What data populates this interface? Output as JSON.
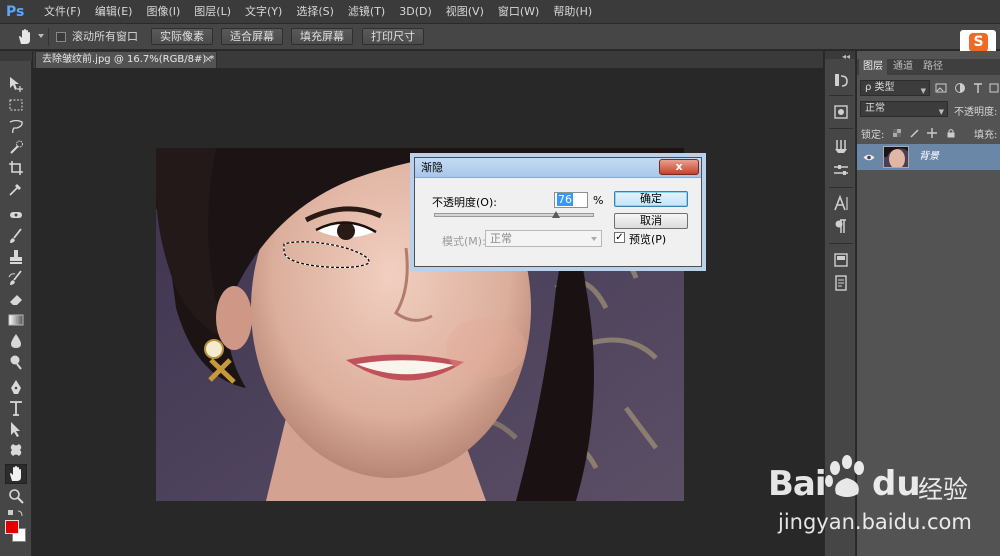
{
  "app": {
    "logo": "Ps",
    "menu": [
      "文件(F)",
      "编辑(E)",
      "图像(I)",
      "图层(L)",
      "文字(Y)",
      "选择(S)",
      "滤镜(T)",
      "3D(D)",
      "视图(V)",
      "窗口(W)",
      "帮助(H)"
    ]
  },
  "options_bar": {
    "tool_icon": "hand-icon",
    "scroll_all_windows_label": "滚动所有窗口",
    "scroll_all_windows_checked": false,
    "buttons": [
      "实际像素",
      "适合屏幕",
      "填充屏幕",
      "打印尺寸"
    ]
  },
  "document": {
    "tab_title": "去除皱纹前.jpg @ 16.7%(RGB/8#) *",
    "close_glyph": "×"
  },
  "fade_dialog": {
    "title": "渐隐",
    "close_glyph": "x",
    "opacity_label": "不透明度(O):",
    "opacity_value": "76",
    "opacity_unit": "%",
    "opacity_slider_level": 0.76,
    "mode_label": "模式(M):",
    "mode_value": "正常",
    "ok_label": "确定",
    "cancel_label": "取消",
    "preview_label": "预览(P)",
    "preview_checked": true,
    "preview_check_glyph": "✓"
  },
  "layers_panel": {
    "tabs": [
      "图层",
      "通道",
      "路径"
    ],
    "active_tab": "图层",
    "filter_label": "ρ 类型",
    "blend_mode": "正常",
    "opacity_label": "不透明度:",
    "lock_label": "锁定:",
    "fill_label": "填充:",
    "layers": [
      {
        "name": "背景",
        "visible": true,
        "selected": true
      }
    ],
    "collapse_glyph": "◂◂"
  },
  "watermark": {
    "brand_bai": "Bai",
    "brand_du": "du",
    "brand_cn": "经验",
    "url": "jingyan.baidu.com"
  },
  "colors": {
    "foreground": "#e00000",
    "background": "#ffffff",
    "workspace": "#282828",
    "panel": "#535353",
    "selected_layer": "#6b87a8",
    "dialog_title": "#a9c7ea"
  }
}
